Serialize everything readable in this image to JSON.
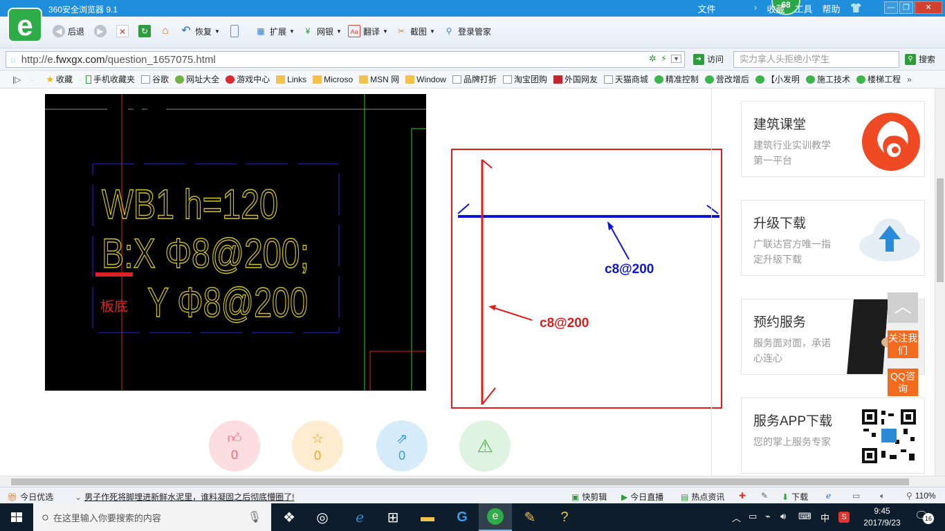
{
  "window": {
    "title": "360安全浏览器 9.1",
    "menu": [
      "文件",
      "收藏",
      "工具",
      "帮助"
    ],
    "score": "68"
  },
  "toolbar": {
    "back": "后退",
    "restore": "恢复",
    "extend": "扩展",
    "bank": "网银",
    "translate": "翻译",
    "screenshot": "截图",
    "login_manager": "登录管家"
  },
  "address": {
    "url_prefix": "http://e.",
    "url_domain": "fwxgx.com",
    "url_path": "/question_1657075.html",
    "visit_label": "访问",
    "search_placeholder": "实力拿人头拒绝小学生",
    "search_label": "搜索"
  },
  "bookmarks": [
    {
      "label": "收藏",
      "icon": "star-icon"
    },
    {
      "label": "手机收藏夹",
      "icon": "phone-icon"
    },
    {
      "label": "谷歌",
      "icon": "page-icon"
    },
    {
      "label": "网址大全",
      "icon": "nav-icon"
    },
    {
      "label": "游戏中心",
      "icon": "game-icon"
    },
    {
      "label": "Links",
      "icon": "folder-icon"
    },
    {
      "label": "Microso",
      "icon": "folder-icon"
    },
    {
      "label": "MSN 网",
      "icon": "folder-icon"
    },
    {
      "label": "Window",
      "icon": "folder-icon"
    },
    {
      "label": "品牌打折",
      "icon": "page-icon"
    },
    {
      "label": "淘宝团购",
      "icon": "page-icon"
    },
    {
      "label": "外国网友",
      "icon": "red-page-icon"
    },
    {
      "label": "天猫商城",
      "icon": "page-icon"
    },
    {
      "label": "精准控制",
      "icon": "wechat-icon"
    },
    {
      "label": "营改增后",
      "icon": "wechat-icon"
    },
    {
      "label": "【小发明",
      "icon": "wechat-icon"
    },
    {
      "label": "施工技术",
      "icon": "wechat-icon"
    },
    {
      "label": "楼梯工程",
      "icon": "wechat-icon"
    }
  ],
  "cad": {
    "line1": "WB1 h=120",
    "line2": "B:X Φ8@200;",
    "line3": "Y Φ8@200",
    "note": "板底"
  },
  "drawing": {
    "blue_label": "c8@200",
    "red_label": "c8@200"
  },
  "reactions": [
    {
      "name": "like",
      "count": "0",
      "icon": "thumbs-up-icon",
      "bg": "#fcdde2",
      "fg": "#f06a80"
    },
    {
      "name": "favorite",
      "count": "0",
      "icon": "star-icon",
      "bg": "#fdecd0",
      "fg": "#f5a623"
    },
    {
      "name": "share",
      "count": "0",
      "icon": "share-icon",
      "bg": "#d6ecfb",
      "fg": "#3a9de0"
    },
    {
      "name": "report",
      "icon": "warning-icon",
      "bg": "#dff4e0",
      "fg": "#4caf50"
    }
  ],
  "sidebar": {
    "cards": [
      {
        "title": "建筑课堂",
        "desc": "建筑行业实训教学第一平台"
      },
      {
        "title": "升级下载",
        "desc": "广联达官方唯一指定升级下载"
      },
      {
        "title": "预约服务",
        "desc": "服务面对面，承诺心连心"
      },
      {
        "title": "服务APP下载",
        "desc": "您的掌上服务专家"
      }
    ],
    "follow_label": "关注我们",
    "qq_label": "QQ咨询"
  },
  "statusbar": {
    "daily": "今日优选",
    "headline": "男子作死将脚埋进新鲜水泥里，谁料凝固之后彻底懵圈了!",
    "quick_clip": "快剪辑",
    "live": "今日直播",
    "hot_news": "热点资讯",
    "download": "下载",
    "zoom": "110%"
  },
  "taskbar": {
    "search_placeholder": "在这里输入你要搜索的内容",
    "ime": "中",
    "time": "9:45",
    "date": "2017/9/23",
    "notifications": "16"
  },
  "colors": {
    "title_bar": "#1f8fdc",
    "accent_green": "#2dac48",
    "drawing_border": "#e21a1a",
    "rebar_blue": "#0a14d8",
    "cad_text": "#d4c61c",
    "float_orange": "#f26b1f"
  }
}
